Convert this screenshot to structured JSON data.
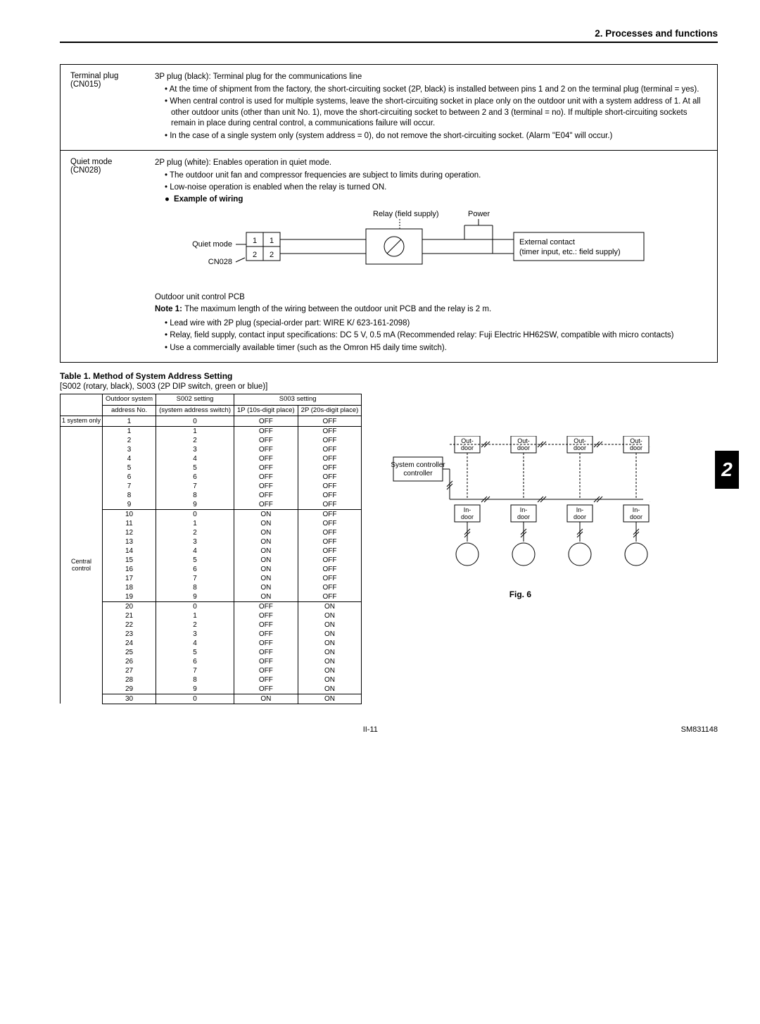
{
  "section_title": "2. Processes and functions",
  "chapter_badge": "2",
  "box1": {
    "label1": "Terminal plug",
    "label2": "(CN015)",
    "lead": "3P plug (black): Terminal plug for the communications line",
    "bullets": [
      "At the time of shipment from the factory, the short-circuiting socket (2P, black) is installed between pins 1 and 2 on the terminal plug (terminal = yes).",
      "When central control is used for multiple systems, leave the short-circuiting socket in place only on the outdoor unit with a system address of 1. At all other outdoor units (other than unit No. 1), move the short-circuiting socket to between 2 and 3 (terminal = no). If multiple short-circuiting sockets remain in place during central control, a communications failure will occur.",
      "In the case of a single system only (system address = 0), do not remove the short-circuiting socket. (Alarm \"E04\" will occur.)"
    ]
  },
  "box2": {
    "label1": "Quiet mode",
    "label2": "(CN028)",
    "lead": "2P plug (white): Enables operation in quiet mode.",
    "bullets_top": [
      "The outdoor unit fan and compressor frequencies are subject to limits during operation.",
      "Low-noise operation is enabled when the relay is turned ON."
    ],
    "example_title": "Example of wiring",
    "diagram": {
      "quiet_mode": "Quiet mode",
      "cn028": "CN028",
      "pin1a": "1",
      "pin1b": "1",
      "pin2a": "2",
      "pin2b": "2",
      "relay_supply": "Relay (field supply)",
      "power": "Power",
      "ext_contact1": "External contact",
      "ext_contact2": "(timer input, etc.: field supply)"
    },
    "pcb_line": "Outdoor unit control PCB",
    "note1_label": "Note 1:",
    "note1_text": "The maximum length of the wiring between the outdoor unit PCB and the relay is 2 m.",
    "bullets_bottom": [
      "Lead wire with 2P plug (special-order part: WIRE K/ 623-161-2098)",
      "Relay, field supply, contact input specifications: DC 5 V, 0.5 mA (Recommended relay: Fuji Electric HH62SW, compatible with micro contacts)",
      "Use a commercially available timer (such as the Omron H5 daily time switch)."
    ]
  },
  "table": {
    "title": "Table 1. Method of System Address Setting",
    "subtitle": "[S002 (rotary, black), S003 (2P DIP switch, green or blue)]",
    "headers": {
      "blank": "",
      "col1a": "Outdoor system",
      "col1b": "address No.",
      "col2a": "S002 setting",
      "col2b": "(system address switch)",
      "col3top": "S003 setting",
      "col3a": "1P (10s-digit place)",
      "col3b": "2P (20s-digit place)"
    },
    "group_single": "1 system only",
    "group_central": "Central control",
    "rows": [
      {
        "g": "single",
        "addr": "1",
        "s002": "0",
        "s003a": "OFF",
        "s003b": "OFF",
        "sep": true
      },
      {
        "g": "central",
        "addr": "1",
        "s002": "1",
        "s003a": "OFF",
        "s003b": "OFF"
      },
      {
        "g": "central",
        "addr": "2",
        "s002": "2",
        "s003a": "OFF",
        "s003b": "OFF"
      },
      {
        "g": "central",
        "addr": "3",
        "s002": "3",
        "s003a": "OFF",
        "s003b": "OFF"
      },
      {
        "g": "central",
        "addr": "4",
        "s002": "4",
        "s003a": "OFF",
        "s003b": "OFF"
      },
      {
        "g": "central",
        "addr": "5",
        "s002": "5",
        "s003a": "OFF",
        "s003b": "OFF"
      },
      {
        "g": "central",
        "addr": "6",
        "s002": "6",
        "s003a": "OFF",
        "s003b": "OFF"
      },
      {
        "g": "central",
        "addr": "7",
        "s002": "7",
        "s003a": "OFF",
        "s003b": "OFF"
      },
      {
        "g": "central",
        "addr": "8",
        "s002": "8",
        "s003a": "OFF",
        "s003b": "OFF"
      },
      {
        "g": "central",
        "addr": "9",
        "s002": "9",
        "s003a": "OFF",
        "s003b": "OFF",
        "sep": true
      },
      {
        "g": "central",
        "addr": "10",
        "s002": "0",
        "s003a": "ON",
        "s003b": "OFF"
      },
      {
        "g": "central",
        "addr": "11",
        "s002": "1",
        "s003a": "ON",
        "s003b": "OFF"
      },
      {
        "g": "central",
        "addr": "12",
        "s002": "2",
        "s003a": "ON",
        "s003b": "OFF"
      },
      {
        "g": "central",
        "addr": "13",
        "s002": "3",
        "s003a": "ON",
        "s003b": "OFF"
      },
      {
        "g": "central",
        "addr": "14",
        "s002": "4",
        "s003a": "ON",
        "s003b": "OFF"
      },
      {
        "g": "central",
        "addr": "15",
        "s002": "5",
        "s003a": "ON",
        "s003b": "OFF"
      },
      {
        "g": "central",
        "addr": "16",
        "s002": "6",
        "s003a": "ON",
        "s003b": "OFF"
      },
      {
        "g": "central",
        "addr": "17",
        "s002": "7",
        "s003a": "ON",
        "s003b": "OFF"
      },
      {
        "g": "central",
        "addr": "18",
        "s002": "8",
        "s003a": "ON",
        "s003b": "OFF"
      },
      {
        "g": "central",
        "addr": "19",
        "s002": "9",
        "s003a": "ON",
        "s003b": "OFF",
        "sep": true
      },
      {
        "g": "central",
        "addr": "20",
        "s002": "0",
        "s003a": "OFF",
        "s003b": "ON"
      },
      {
        "g": "central",
        "addr": "21",
        "s002": "1",
        "s003a": "OFF",
        "s003b": "ON"
      },
      {
        "g": "central",
        "addr": "22",
        "s002": "2",
        "s003a": "OFF",
        "s003b": "ON"
      },
      {
        "g": "central",
        "addr": "23",
        "s002": "3",
        "s003a": "OFF",
        "s003b": "ON"
      },
      {
        "g": "central",
        "addr": "24",
        "s002": "4",
        "s003a": "OFF",
        "s003b": "ON"
      },
      {
        "g": "central",
        "addr": "25",
        "s002": "5",
        "s003a": "OFF",
        "s003b": "ON"
      },
      {
        "g": "central",
        "addr": "26",
        "s002": "6",
        "s003a": "OFF",
        "s003b": "ON"
      },
      {
        "g": "central",
        "addr": "27",
        "s002": "7",
        "s003a": "OFF",
        "s003b": "ON"
      },
      {
        "g": "central",
        "addr": "28",
        "s002": "8",
        "s003a": "OFF",
        "s003b": "ON"
      },
      {
        "g": "central",
        "addr": "29",
        "s002": "9",
        "s003a": "OFF",
        "s003b": "ON",
        "sep": true
      },
      {
        "g": "central",
        "addr": "30",
        "s002": "0",
        "s003a": "ON",
        "s003b": "ON",
        "sep": true
      }
    ]
  },
  "fig6": {
    "caption": "Fig. 6",
    "system_controller": "System controller",
    "outdoor": "Out-door",
    "indoor": "In-door"
  },
  "footer": {
    "page": "II-11",
    "doc": "SM831148"
  }
}
